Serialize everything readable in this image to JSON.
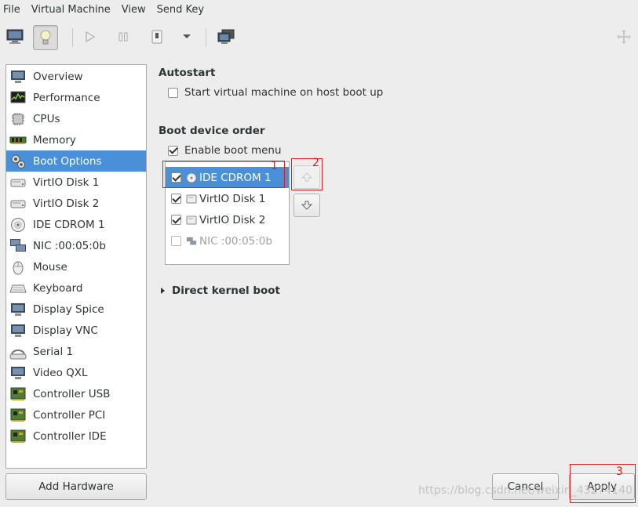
{
  "menu": [
    "File",
    "Virtual Machine",
    "View",
    "Send Key"
  ],
  "sidebar": {
    "items": [
      {
        "label": "Overview",
        "icon": "monitor-icon"
      },
      {
        "label": "Performance",
        "icon": "performance-graph-icon"
      },
      {
        "label": "CPUs",
        "icon": "cpu-chip-icon"
      },
      {
        "label": "Memory",
        "icon": "memory-module-icon"
      },
      {
        "label": "Boot Options",
        "icon": "boot-options-gears-icon"
      },
      {
        "label": "VirtIO Disk 1",
        "icon": "hard-disk-icon"
      },
      {
        "label": "VirtIO Disk 2",
        "icon": "hard-disk-icon"
      },
      {
        "label": "IDE CDROM 1",
        "icon": "cdrom-icon"
      },
      {
        "label": "NIC :00:05:0b",
        "icon": "network-icon"
      },
      {
        "label": "Mouse",
        "icon": "mouse-icon"
      },
      {
        "label": "Keyboard",
        "icon": "keyboard-icon"
      },
      {
        "label": "Display Spice",
        "icon": "display-icon"
      },
      {
        "label": "Display VNC",
        "icon": "display-icon"
      },
      {
        "label": "Serial 1",
        "icon": "serial-port-icon"
      },
      {
        "label": "Video QXL",
        "icon": "display-icon"
      },
      {
        "label": "Controller USB",
        "icon": "controller-card-icon"
      },
      {
        "label": "Controller PCI",
        "icon": "controller-card-icon"
      },
      {
        "label": "Controller IDE",
        "icon": "controller-card-icon"
      }
    ],
    "add_hardware": "Add Hardware"
  },
  "autostart": {
    "title": "Autostart",
    "checkbox_label": "Start virtual machine on host boot up"
  },
  "boot": {
    "title": "Boot device order",
    "enable_menu_label": "Enable boot menu",
    "devices": [
      {
        "label": "IDE CDROM 1",
        "checked": true
      },
      {
        "label": "VirtIO Disk 1",
        "checked": true
      },
      {
        "label": "VirtIO Disk 2",
        "checked": true
      },
      {
        "label": "NIC :00:05:0b",
        "checked": false
      }
    ]
  },
  "kernel": {
    "title": "Direct kernel boot"
  },
  "annotations": [
    "1",
    "2",
    "3"
  ],
  "buttons": {
    "cancel": "Cancel",
    "apply": "Apply"
  },
  "watermark": "https://blog.csdn.net/weixin_43274140",
  "colors": {
    "selection": "#4a90d9",
    "annotation": "#e01b1b"
  }
}
